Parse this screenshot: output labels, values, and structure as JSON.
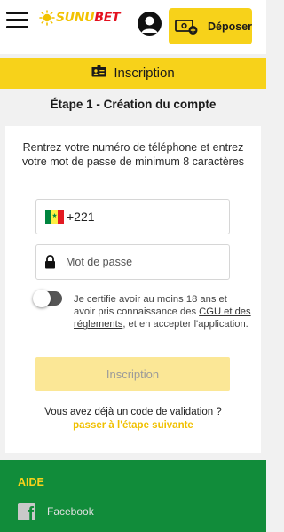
{
  "header": {
    "logo_sunu": "SUNU",
    "logo_bet": "BET",
    "deposit_label": "Déposer"
  },
  "banner": {
    "label": "Inscription"
  },
  "step": {
    "title": "Étape 1 - Création du compte"
  },
  "form": {
    "description": "Rentrez votre numéro de téléphone et entrez votre mot de passe de minimum 8 caractères",
    "phone_prefix": "+221",
    "password_placeholder": "Mot de passe",
    "certify_before": "Je certifie avoir au moins 18 ans et avoir pris connaissance des ",
    "certify_link": "CGU et des réglements",
    "certify_after": ", et en accepter l'application.",
    "submit_label": "Inscription",
    "validation_question": "Vous avez déjà un code de validation ?",
    "next_step_link": "passer à l'étape suivante"
  },
  "footer": {
    "section_title": "AIDE",
    "facebook_label": "Facebook"
  },
  "colors": {
    "brand_yellow": "#f7d21a",
    "brand_red": "#e4101e",
    "footer_green": "#118c3a",
    "submit_disabled": "#fbe796"
  },
  "icons": [
    "menu-icon",
    "logo-sun-icon",
    "user-icon",
    "wallet-add-icon",
    "id-card-icon",
    "senegal-flag-icon",
    "lock-icon",
    "facebook-icon"
  ]
}
